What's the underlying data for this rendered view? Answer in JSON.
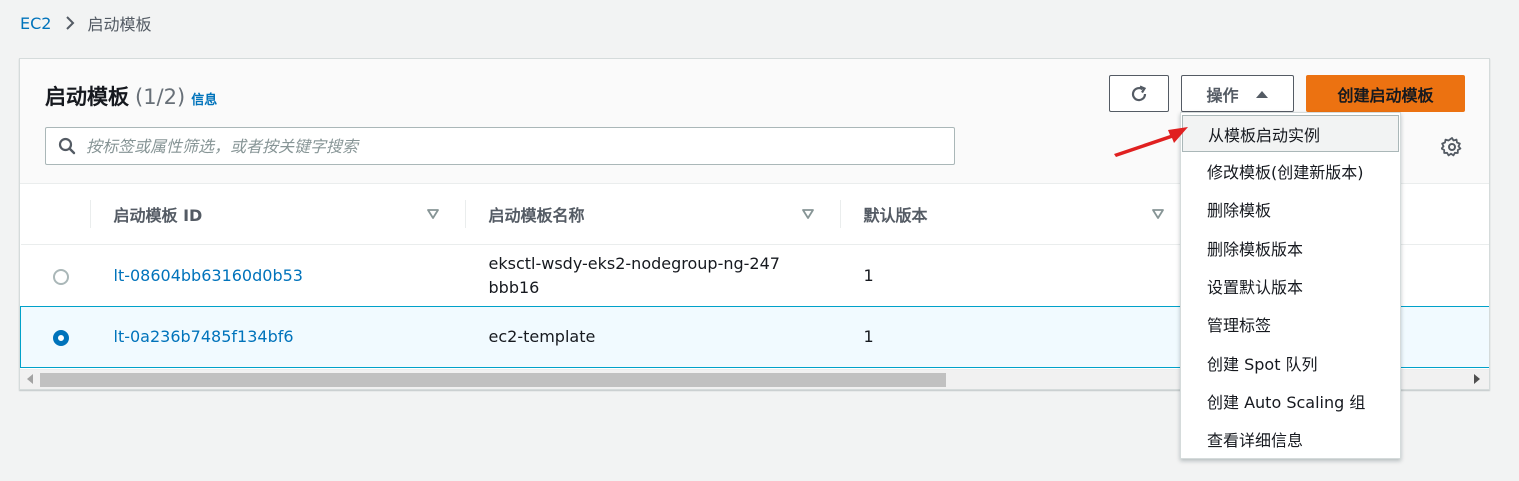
{
  "breadcrumb": {
    "root": "EC2",
    "current": "启动模板"
  },
  "panel": {
    "title": "启动模板",
    "count": "(1/2)",
    "info_link": "信息",
    "search_placeholder": "按标签或属性筛选，或者按关键字搜索",
    "actions_label": "操作",
    "create_label": "创建启动模板"
  },
  "table": {
    "columns": [
      "启动模板 ID",
      "启动模板名称",
      "默认版本"
    ],
    "rows": [
      {
        "id": "lt-08604bb63160d0b53",
        "name": "eksctl-wsdy-eks2-nodegroup-ng-247bbb16",
        "version": "1",
        "selected": false
      },
      {
        "id": "lt-0a236b7485f134bf6",
        "name": "ec2-template",
        "version": "1",
        "selected": true
      }
    ]
  },
  "dropdown": {
    "items": [
      "从模板启动实例",
      "修改模板(创建新版本)",
      "删除模板",
      "删除模板版本",
      "设置默认版本",
      "管理标签",
      "创建 Spot 队列",
      "创建 Auto Scaling 组",
      "查看详细信息"
    ],
    "highlighted_index": 0
  },
  "icons": {
    "breadcrumb_separator": "chevron-right-icon",
    "search": "search-icon",
    "refresh": "refresh-icon",
    "actions_caret": "caret-up-icon",
    "settings": "gear-icon",
    "sort": "sort-down-icon"
  },
  "colors": {
    "accent": "#0073bb",
    "primary_button": "#ec7211",
    "selected_row": "#f1faff",
    "annotation_arrow": "#e02020"
  }
}
